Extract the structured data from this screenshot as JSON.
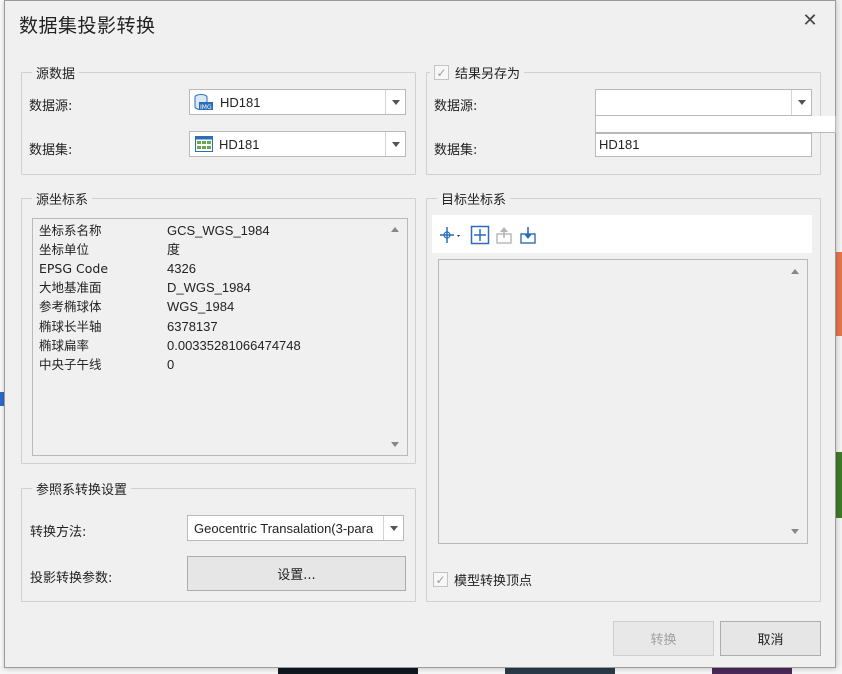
{
  "dialog": {
    "title": "数据集投影转换",
    "close_glyph": "✕"
  },
  "source_data": {
    "group_title": "源数据",
    "datasource_label": "数据源:",
    "datasource_value": "HD181",
    "datasource_icon": "database-icon",
    "dataset_label": "数据集:",
    "dataset_value": "HD181",
    "dataset_icon": "grid-dataset-icon"
  },
  "result_save_as": {
    "checkbox_label": "结果另存为",
    "checked": true,
    "datasource_label": "数据源:",
    "datasource_value": "",
    "dataset_label": "数据集:",
    "dataset_value": "HD181"
  },
  "source_crs": {
    "group_title": "源坐标系",
    "rows": [
      {
        "key": "坐标系名称",
        "value": "GCS_WGS_1984"
      },
      {
        "key": "坐标单位",
        "value": "度"
      },
      {
        "key": "EPSG Code",
        "value": "4326"
      },
      {
        "key": "大地基准面",
        "value": "D_WGS_1984"
      },
      {
        "key": "参考椭球体",
        "value": "WGS_1984"
      },
      {
        "key": "椭球长半轴",
        "value": "6378137"
      },
      {
        "key": "椭球扁率",
        "value": "0.00335281066474748"
      },
      {
        "key": "中央子午线",
        "value": "0"
      }
    ]
  },
  "target_crs": {
    "group_title": "目标坐标系",
    "toolbar_icons": [
      "crs-select-icon",
      "crs-favorite-icon",
      "export-icon",
      "import-icon"
    ]
  },
  "transform_settings": {
    "group_title": "参照系转换设置",
    "method_label": "转换方法:",
    "method_value": "Geocentric Transalation(3-para",
    "params_label": "投影转换参数:",
    "params_button": "设置..."
  },
  "model_vertex": {
    "checkbox_label": "模型转换顶点",
    "checked": true
  },
  "footer": {
    "convert_button": "转换",
    "convert_enabled": false,
    "cancel_button": "取消"
  },
  "colors": {
    "dialog_bg": "#f0f0f0",
    "icon_blue": "#2a6ebb",
    "disabled_text": "#a0a0a0"
  }
}
